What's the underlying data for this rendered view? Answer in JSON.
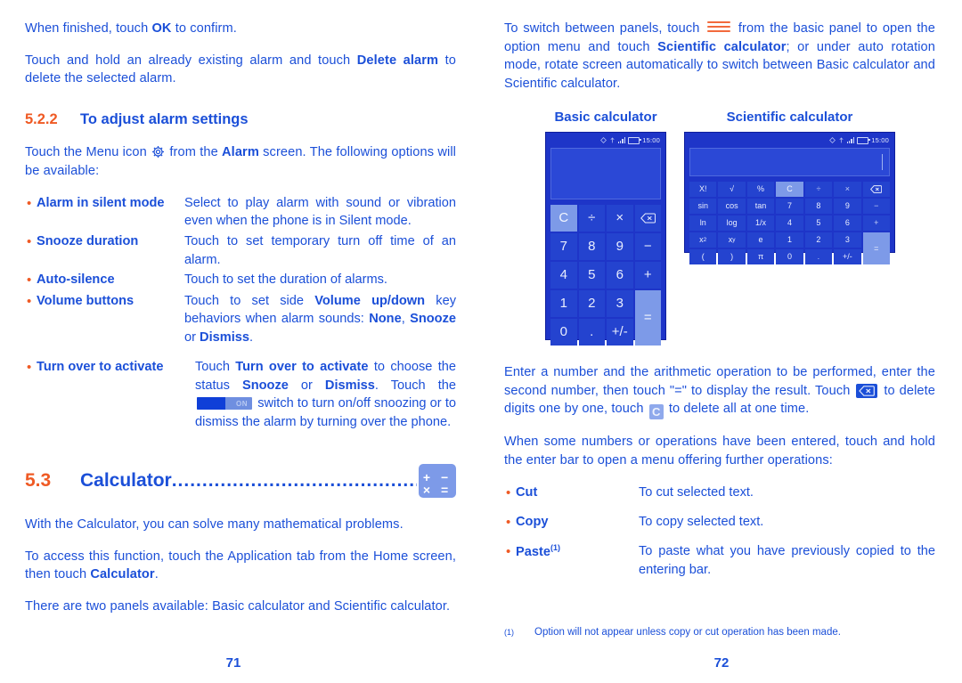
{
  "left": {
    "para_ok": {
      "pre": "When finished, touch ",
      "bold": "OK",
      "post": " to confirm."
    },
    "para_delete": {
      "pre": "Touch and hold an already existing alarm and touch ",
      "bold": "Delete alarm",
      "post": " to delete the selected alarm."
    },
    "heading_522": {
      "number": "5.2.2",
      "title": "To adjust alarm settings"
    },
    "para_menu": {
      "pre": "Touch the Menu icon ",
      "icon": "gear-icon",
      "mid": " from the ",
      "bold": "Alarm",
      "post": " screen. The following options will be available:"
    },
    "options": [
      {
        "bullet": "•",
        "term": "Alarm in silent mode",
        "desc": "Select to play alarm with sound or vibration even when the phone is in Silent mode."
      },
      {
        "bullet": "•",
        "term": "Snooze duration",
        "desc": "Touch to set temporary turn off time of an alarm."
      },
      {
        "bullet": "•",
        "term": "Auto-silence",
        "desc": "Touch to set the duration of alarms."
      },
      {
        "bullet": "•",
        "term": "Volume buttons",
        "desc_parts": {
          "p1": "Touch to set side ",
          "b1": "Volume up/down",
          "p2": " key behaviors when alarm sounds: ",
          "b2": "None",
          "p3": ", ",
          "b3": "Snooze",
          "p4": " or ",
          "b4": "Dismiss",
          "p5": "."
        }
      },
      {
        "bullet": "•",
        "term": "Turn over to activate",
        "desc_parts": {
          "p1": "Touch ",
          "b1": "Turn over to activate",
          "p2": " to choose the status ",
          "b2": "Snooze",
          "p3": " or ",
          "b3": "Dismiss",
          "p4": ". Touch the ",
          "toggle_label": "ON",
          "p5": " switch  to turn on/off snoozing or to dismiss the alarm by turning over the phone."
        }
      }
    ],
    "heading_53": {
      "number": "5.3",
      "title": "Calculator",
      "dots": "...........................................................",
      "icon_row1": "+ −",
      "icon_row2": "× ="
    },
    "para_solve": "With the Calculator, you can solve many mathematical problems.",
    "para_access": {
      "pre": "To access this function, touch the Application tab from the Home screen, then touch ",
      "bold": "Calculator",
      "post": "."
    },
    "para_panels": "There are two panels available: Basic calculator and Scientific calculator.",
    "folio": "71"
  },
  "right": {
    "para_switch": {
      "p1": "To switch between panels, touch ",
      "icon": "hamburger-menu-icon",
      "p2": " from the basic panel to open the option menu and touch ",
      "b1": "Scientific calculator",
      "p3": "; or under auto rotation mode, rotate screen automatically to switch between Basic calculator and Scientific calculator."
    },
    "screenshots": {
      "basic": {
        "caption": "Basic calculator",
        "statusbar": {
          "time": "15:00"
        },
        "keys": [
          {
            "label": "C",
            "style": "light",
            "name": "clear-key"
          },
          {
            "label": "÷",
            "style": "normal",
            "name": "divide-key"
          },
          {
            "label": "×",
            "style": "normal",
            "name": "multiply-key"
          },
          {
            "label": "backspace-icon",
            "style": "icon",
            "name": "backspace-key"
          },
          {
            "label": "7",
            "style": "normal",
            "name": "digit-7-key"
          },
          {
            "label": "8",
            "style": "normal",
            "name": "digit-8-key"
          },
          {
            "label": "9",
            "style": "normal",
            "name": "digit-9-key"
          },
          {
            "label": "−",
            "style": "normal",
            "name": "minus-key"
          },
          {
            "label": "4",
            "style": "normal",
            "name": "digit-4-key"
          },
          {
            "label": "5",
            "style": "normal",
            "name": "digit-5-key"
          },
          {
            "label": "6",
            "style": "normal",
            "name": "digit-6-key"
          },
          {
            "label": "+",
            "style": "normal",
            "name": "plus-key"
          },
          {
            "label": "1",
            "style": "normal",
            "name": "digit-1-key"
          },
          {
            "label": "2",
            "style": "normal",
            "name": "digit-2-key"
          },
          {
            "label": "3",
            "style": "normal",
            "name": "digit-3-key"
          },
          {
            "label": "=",
            "style": "equals",
            "name": "equals-key"
          },
          {
            "label": "0",
            "style": "normal",
            "name": "digit-0-key"
          },
          {
            "label": ".",
            "style": "normal",
            "name": "decimal-key"
          },
          {
            "label": "+/-",
            "style": "normal",
            "name": "sign-key"
          }
        ]
      },
      "scientific": {
        "caption": "Scientific calculator",
        "statusbar": {
          "time": "15:00"
        },
        "rows": [
          [
            {
              "label": "X!",
              "style": "normal",
              "name": "factorial-key"
            },
            {
              "label": "√",
              "style": "normal",
              "name": "sqrt-key"
            },
            {
              "label": "%",
              "style": "normal",
              "name": "percent-key"
            },
            {
              "label": "C",
              "style": "light",
              "name": "clear-key"
            },
            {
              "label": "÷",
              "style": "dim",
              "name": "divide-key"
            },
            {
              "label": "×",
              "style": "dim",
              "name": "multiply-key"
            },
            {
              "label": "backspace-icon",
              "style": "icon",
              "name": "backspace-key"
            }
          ],
          [
            {
              "label": "sin",
              "style": "normal",
              "name": "sin-key"
            },
            {
              "label": "cos",
              "style": "normal",
              "name": "cos-key"
            },
            {
              "label": "tan",
              "style": "normal",
              "name": "tan-key"
            },
            {
              "label": "7",
              "style": "normal",
              "name": "digit-7-key"
            },
            {
              "label": "8",
              "style": "normal",
              "name": "digit-8-key"
            },
            {
              "label": "9",
              "style": "normal",
              "name": "digit-9-key"
            },
            {
              "label": "−",
              "style": "dim",
              "name": "minus-key"
            }
          ],
          [
            {
              "label": "ln",
              "style": "normal",
              "name": "ln-key"
            },
            {
              "label": "log",
              "style": "normal",
              "name": "log-key"
            },
            {
              "label": "1/x",
              "style": "normal",
              "name": "reciprocal-key"
            },
            {
              "label": "4",
              "style": "normal",
              "name": "digit-4-key"
            },
            {
              "label": "5",
              "style": "normal",
              "name": "digit-5-key"
            },
            {
              "label": "6",
              "style": "normal",
              "name": "digit-6-key"
            },
            {
              "label": "+",
              "style": "dim",
              "name": "plus-key"
            }
          ],
          [
            {
              "label": "x2",
              "style": "sup",
              "base": "x",
              "exp": "2",
              "name": "square-key"
            },
            {
              "label": "xy",
              "style": "sup",
              "base": "x",
              "exp": "y",
              "name": "power-key"
            },
            {
              "label": "e",
              "style": "normal",
              "name": "e-key"
            },
            {
              "label": "1",
              "style": "normal",
              "name": "digit-1-key"
            },
            {
              "label": "2",
              "style": "normal",
              "name": "digit-2-key"
            },
            {
              "label": "3",
              "style": "normal",
              "name": "digit-3-key"
            },
            {
              "label": "=",
              "style": "equals",
              "name": "equals-key"
            }
          ],
          [
            {
              "label": "(",
              "style": "normal",
              "name": "open-paren-key"
            },
            {
              "label": ")",
              "style": "normal",
              "name": "close-paren-key"
            },
            {
              "label": "π",
              "style": "normal",
              "name": "pi-key"
            },
            {
              "label": "0",
              "style": "normal",
              "name": "digit-0-key"
            },
            {
              "label": ".",
              "style": "dim",
              "name": "decimal-key"
            },
            {
              "label": "+/-",
              "style": "normal",
              "name": "sign-key"
            }
          ]
        ]
      }
    },
    "para_enter": {
      "p1": "Enter a number and the arithmetic operation to be performed, enter the second number, then touch \"=\" to display the result. Touch ",
      "icon1": "backspace-icon",
      "p2": " to delete digits one by one, touch ",
      "icon2": "clear-c-icon",
      "p3": " to delete all at one time."
    },
    "para_hold": "When some numbers or operations have been entered, touch and hold the enter bar to open a menu offering further operations:",
    "operations": [
      {
        "bullet": "•",
        "term": "Cut",
        "desc": "To cut selected text."
      },
      {
        "bullet": "•",
        "term": "Copy",
        "desc": "To copy selected text."
      },
      {
        "bullet": "•",
        "term": "Paste",
        "sup": "(1)",
        "desc": "To paste what you have previously copied to the entering bar."
      }
    ],
    "footnote": {
      "mark": "(1)",
      "text": "Option will not appear unless copy or cut operation has been made."
    },
    "folio": "72"
  }
}
